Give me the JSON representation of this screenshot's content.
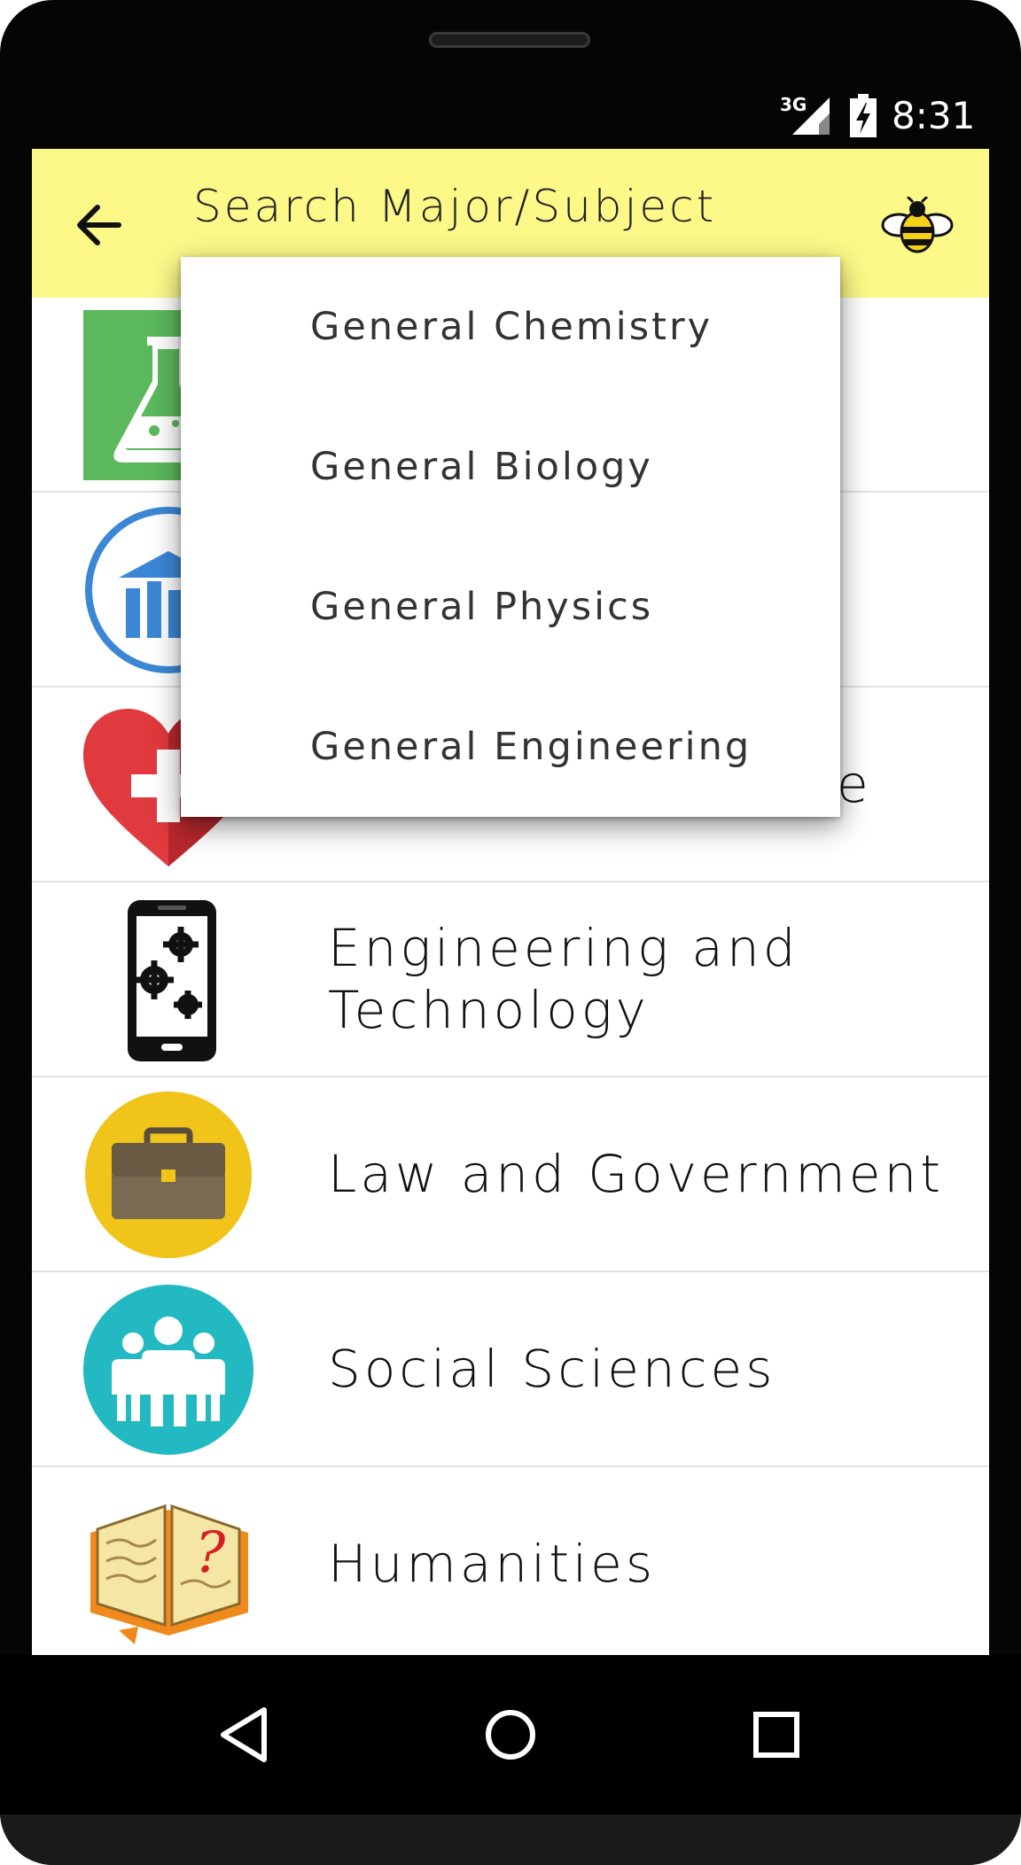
{
  "status_bar": {
    "network": "3G",
    "time": "8:31"
  },
  "app_bar": {
    "title": "Search Major/Subject",
    "back_icon": "arrow-left-icon",
    "logo_icon": "bee-icon"
  },
  "categories": [
    {
      "label": "",
      "icon": "flask-icon"
    },
    {
      "label": "",
      "icon": "bank-chart-icon"
    },
    {
      "label": "e",
      "icon": "heart-plus-icon"
    },
    {
      "label": "Engineering and Technology",
      "icon": "phone-gears-icon"
    },
    {
      "label": "Law and Government",
      "icon": "briefcase-icon"
    },
    {
      "label": "Social Sciences",
      "icon": "people-icon"
    },
    {
      "label": "Humanities",
      "icon": "book-question-icon"
    }
  ],
  "dropdown": {
    "items": [
      {
        "label": "General Chemistry"
      },
      {
        "label": "General Biology"
      },
      {
        "label": "General Physics"
      },
      {
        "label": "General Engineering"
      }
    ]
  },
  "nav_bar": {
    "back": "triangle-back-icon",
    "home": "circle-home-icon",
    "recents": "square-recents-icon"
  },
  "colors": {
    "app_bar": "#fcf989",
    "flask_bg": "#5cb85c",
    "bank_blue": "#3b87d6",
    "heart_red": "#e0393e",
    "briefcase_bg": "#f0c419",
    "people_bg": "#22b9c2"
  }
}
